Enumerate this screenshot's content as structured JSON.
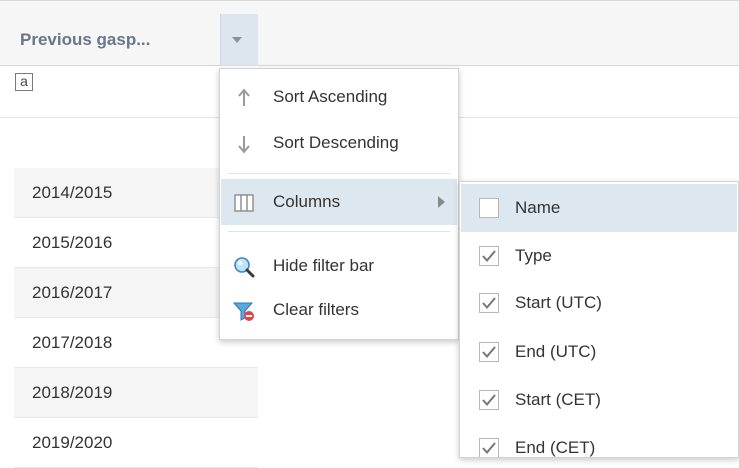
{
  "header": {
    "column_title": "Previous gasp..."
  },
  "filter": {
    "text_filter_glyph": "a"
  },
  "rows": [
    "2014/2015",
    "2015/2016",
    "2016/2017",
    "2017/2018",
    "2018/2019",
    "2019/2020"
  ],
  "menu": {
    "sort_asc": "Sort Ascending",
    "sort_desc": "Sort Descending",
    "columns": "Columns",
    "hide_filter_bar": "Hide filter bar",
    "clear_filters": "Clear filters"
  },
  "columns_menu": {
    "items": [
      {
        "label": "Name",
        "checked": false
      },
      {
        "label": "Type",
        "checked": true
      },
      {
        "label": "Start (UTC)",
        "checked": true
      },
      {
        "label": "End (UTC)",
        "checked": true
      },
      {
        "label": "Start (CET)",
        "checked": true
      },
      {
        "label": "End (CET)",
        "checked": true
      }
    ]
  },
  "colors": {
    "highlight": "#dce7f0",
    "header_bg": "#f6f6f6",
    "header_text": "#6b7686"
  }
}
